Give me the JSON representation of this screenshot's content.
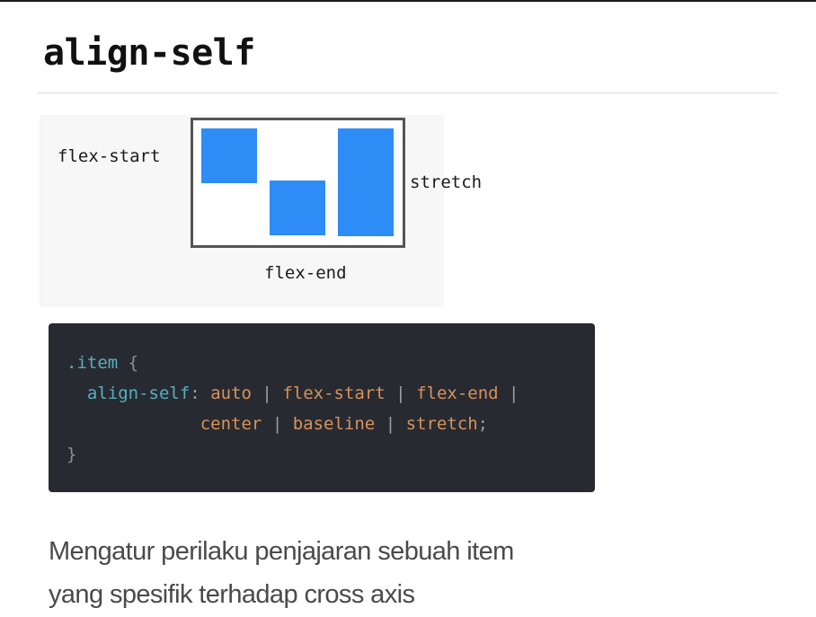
{
  "slide": {
    "title": "align-self"
  },
  "diagram": {
    "labels": {
      "flex_start": "flex-start",
      "stretch": "stretch",
      "flex_end": "flex-end"
    },
    "colors": {
      "item": "#2d8cf5",
      "container_border": "#555555"
    }
  },
  "code": {
    "line1": {
      "selector": ".item",
      "brace": "{"
    },
    "line2": {
      "property": "align-self",
      "colon": ":",
      "values": [
        "auto",
        "flex-start",
        "flex-end"
      ],
      "separator": "|"
    },
    "line3": {
      "values": [
        "center",
        "baseline",
        "stretch"
      ],
      "separator": "|",
      "terminator": ";"
    },
    "line4": {
      "brace": "}"
    },
    "colors": {
      "background": "#282a31",
      "selector": "#56b0c0",
      "value": "#d6935a"
    }
  },
  "description": {
    "line1": "Mengatur perilaku penjajaran sebuah item",
    "line2": "yang spesifik terhadap cross axis"
  }
}
